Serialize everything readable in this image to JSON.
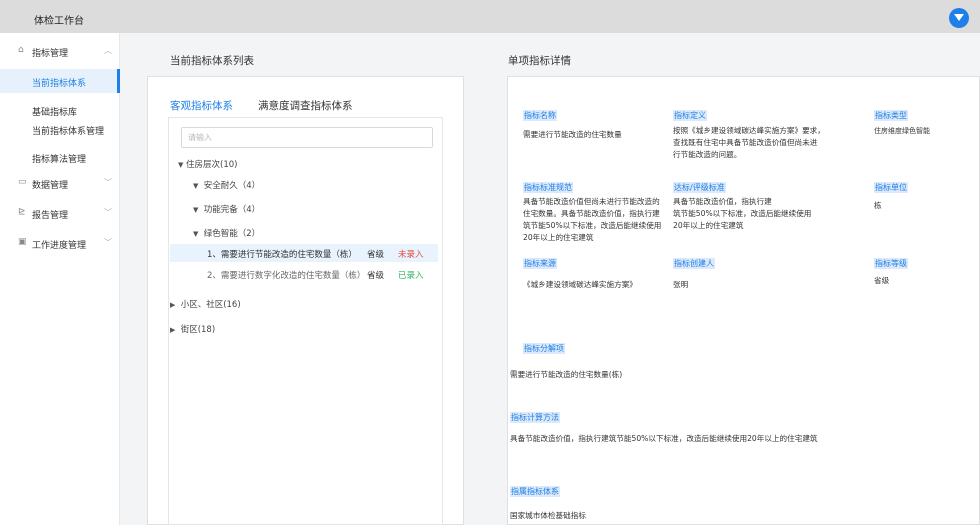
{
  "header": {
    "app_title": "体检工作台"
  },
  "sidebar": {
    "groups": [
      {
        "label": "指标管理",
        "icon": "home-icon"
      },
      {
        "label": "数据管理",
        "icon": "data-icon"
      },
      {
        "label": "报告管理",
        "icon": "chart-icon"
      },
      {
        "label": "工作进度管理",
        "icon": "progress-icon"
      }
    ],
    "items": [
      {
        "label": "当前指标体系"
      },
      {
        "label": "基础指标库"
      },
      {
        "label": "当前指标体系管理"
      },
      {
        "label": "指标算法管理"
      }
    ]
  },
  "list_panel": {
    "title": "当前指标体系列表",
    "tabs": [
      "客观指标体系",
      "满意度调查指标体系"
    ],
    "search_placeholder": "请输入",
    "tree": {
      "root": "住房层次(10)",
      "subs": [
        "安全耐久（4）",
        "功能完备（4）",
        "绿色智能（2）"
      ],
      "leaves": [
        {
          "name": "1、需要进行节能改造的住宅数量（栋）",
          "level": "省级",
          "status": "未录入",
          "status_color": "#e54d42"
        },
        {
          "name": "2、需要进行数字化改造的住宅数量（栋）",
          "level": "省级",
          "status": "已录入",
          "status_color": "#2db35d"
        }
      ],
      "others": [
        "小区、社区(16)",
        "街区(18)"
      ]
    }
  },
  "detail_panel": {
    "title": "单项指标详情",
    "fields": {
      "name_label": "指标名称",
      "name_value": "需要进行节能改造的住宅数量",
      "def_label": "指标定义",
      "def_value": [
        "按照《城乡建设领域碳达峰实施方案》要求，",
        "查找既有住宅中具备节能改造价值但尚未进",
        "行节能改造的问题。"
      ],
      "type_label": "指标类型",
      "type_value": "住房维度绿色智能",
      "norm_label": "指标标准规范",
      "norm_value": [
        "具备节能改造价值但尚未进行节能改造的",
        "住宅数量。具备节能改造价值，指执行建",
        "筑节能50%以下标准，改造后能继续使用",
        "20年以上的住宅建筑"
      ],
      "std_label": "达标/评级标准",
      "std_value": [
        "具备节能改造价值，指执行建",
        "筑节能50%以下标准，改造后能继续使用",
        "20年以上的住宅建筑"
      ],
      "unit_label": "指标单位",
      "unit_value": "栋",
      "source_label": "指标来源",
      "source_value": "《城乡建设领域碳达峰实施方案》",
      "creator_label": "指标创建人",
      "creator_value": "张明",
      "grade_label": "指标等级",
      "grade_value": "省级",
      "decomp_label": "指标分解项",
      "decomp_value": "需要进行节能改造的住宅数量(栋)",
      "calc_label": "指标计算方法",
      "calc_value": "具备节能改造价值，指执行建筑节能50%以下标准，改造后能继续使用20年以上的住宅建筑",
      "system_label": "指属指标体系",
      "system_value": "国家城市体检基础指标"
    }
  },
  "colors": {
    "accent": "#1e7fe8",
    "unentered": "#e54d42",
    "entered": "#2db35d"
  }
}
